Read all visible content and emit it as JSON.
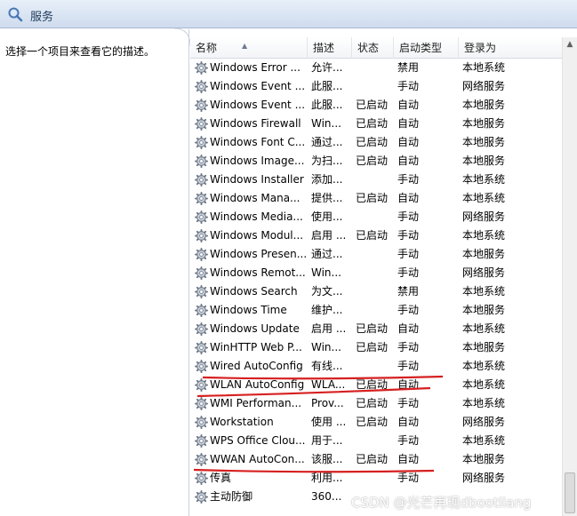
{
  "window": {
    "title": "服务",
    "icon": "magnifier-icon"
  },
  "left_pane": {
    "description_prompt": "选择一个项目来查看它的描述。"
  },
  "columns": [
    "名称",
    "描述",
    "状态",
    "启动类型",
    "登录为"
  ],
  "services": [
    {
      "name": "Windows Error ...",
      "description": "允许...",
      "status": "",
      "startup": "禁用",
      "logon": "本地系统"
    },
    {
      "name": "Windows Event ...",
      "description": "此服...",
      "status": "",
      "startup": "手动",
      "logon": "网络服务"
    },
    {
      "name": "Windows Event ...",
      "description": "此服...",
      "status": "已启动",
      "startup": "自动",
      "logon": "本地服务"
    },
    {
      "name": "Windows Firewall",
      "description": "Win...",
      "status": "已启动",
      "startup": "自动",
      "logon": "本地服务"
    },
    {
      "name": "Windows Font C...",
      "description": "通过...",
      "status": "已启动",
      "startup": "自动",
      "logon": "本地服务"
    },
    {
      "name": "Windows Image...",
      "description": "为扫...",
      "status": "已启动",
      "startup": "自动",
      "logon": "本地服务"
    },
    {
      "name": "Windows Installer",
      "description": "添加...",
      "status": "",
      "startup": "手动",
      "logon": "本地系统"
    },
    {
      "name": "Windows Mana...",
      "description": "提供...",
      "status": "已启动",
      "startup": "自动",
      "logon": "本地系统"
    },
    {
      "name": "Windows Media...",
      "description": "使用...",
      "status": "",
      "startup": "手动",
      "logon": "网络服务"
    },
    {
      "name": "Windows Modul...",
      "description": "启用 ...",
      "status": "已启动",
      "startup": "手动",
      "logon": "本地系统"
    },
    {
      "name": "Windows Presen...",
      "description": "通过...",
      "status": "",
      "startup": "手动",
      "logon": "本地服务"
    },
    {
      "name": "Windows Remot...",
      "description": "Win...",
      "status": "",
      "startup": "手动",
      "logon": "网络服务"
    },
    {
      "name": "Windows Search",
      "description": "为文...",
      "status": "",
      "startup": "禁用",
      "logon": "本地系统"
    },
    {
      "name": "Windows Time",
      "description": "维护...",
      "status": "",
      "startup": "手动",
      "logon": "本地服务"
    },
    {
      "name": "Windows Update",
      "description": "启用 ...",
      "status": "已启动",
      "startup": "自动",
      "logon": "本地系统"
    },
    {
      "name": "WinHTTP Web P...",
      "description": "Win...",
      "status": "已启动",
      "startup": "手动",
      "logon": "本地服务"
    },
    {
      "name": "Wired AutoConfig",
      "description": "有线...",
      "status": "",
      "startup": "手动",
      "logon": "本地系统"
    },
    {
      "name": "WLAN AutoConfig",
      "description": "WLA...",
      "status": "已启动",
      "startup": "自动",
      "logon": "本地系统"
    },
    {
      "name": "WMI Performan...",
      "description": "Prov...",
      "status": "已启动",
      "startup": "手动",
      "logon": "本地系统"
    },
    {
      "name": "Workstation",
      "description": "使用 ...",
      "status": "已启动",
      "startup": "自动",
      "logon": "网络服务"
    },
    {
      "name": "WPS Office Clou...",
      "description": "用于...",
      "status": "",
      "startup": "手动",
      "logon": "本地系统"
    },
    {
      "name": "WWAN AutoCon...",
      "description": "该服...",
      "status": "已启动",
      "startup": "自动",
      "logon": "本地服务"
    },
    {
      "name": "传真",
      "description": "利用...",
      "status": "",
      "startup": "手动",
      "logon": "网络服务"
    },
    {
      "name": "主动防御",
      "description": "360...",
      "status": "",
      "startup": "",
      "logon": ""
    }
  ],
  "watermark": "CSDN @光芒再现dbootliang"
}
